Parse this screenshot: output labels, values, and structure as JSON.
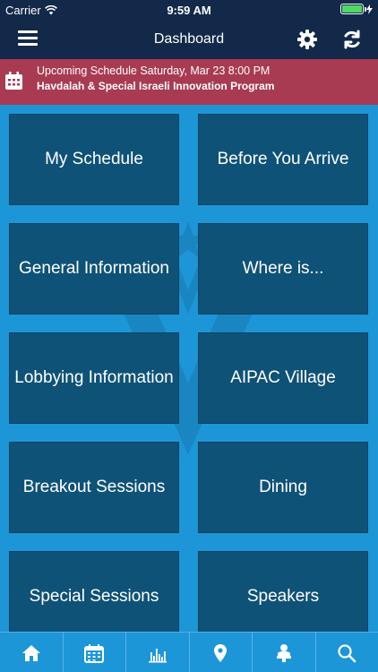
{
  "status_bar": {
    "carrier": "Carrier",
    "time": "9:59 AM",
    "battery_color": "#4cd964"
  },
  "nav": {
    "title": "Dashboard",
    "menu_icon": "hamburger-menu-icon",
    "settings_icon": "gear-icon",
    "refresh_icon": "refresh-icon"
  },
  "banner": {
    "line1": "Upcoming Schedule Saturday, Mar 23 8:00 PM",
    "line2": "Havdalah & Special Israeli Innovation Program",
    "icon": "calendar-icon",
    "color": "#a83b52"
  },
  "tiles": [
    "My Schedule",
    "Before You Arrive",
    "General Information",
    "Where is...",
    "Lobbying Information",
    "AIPAC Village",
    "Breakout Sessions",
    "Dining",
    "Special Sessions",
    "Speakers"
  ],
  "tab_bar": {
    "icons": [
      "home-icon",
      "calendar-icon",
      "chart-icon",
      "map-pin-icon",
      "speaker-icon",
      "search-icon"
    ]
  },
  "colors": {
    "navy": "#13294a",
    "background_blue": "#1d96d8",
    "tile": "#0f5278"
  }
}
